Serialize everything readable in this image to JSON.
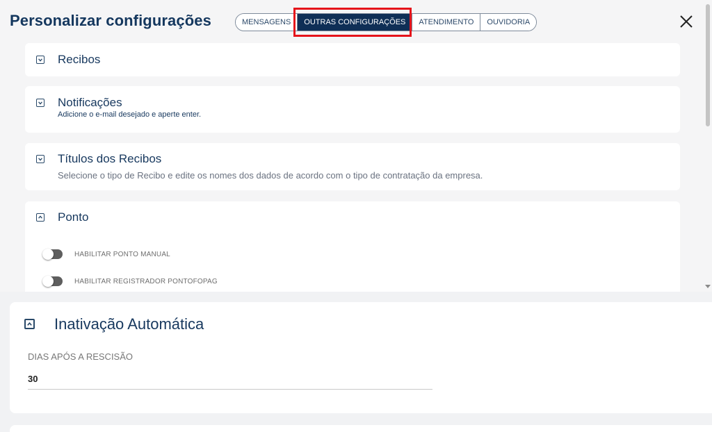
{
  "modal": {
    "title": "Personalizar configurações",
    "tabs": [
      {
        "label": "MENSAGENS",
        "active": false
      },
      {
        "label": "OUTRAS CONFIGURAÇÕES",
        "active": true
      },
      {
        "label": "ATENDIMENTO",
        "active": false
      },
      {
        "label": "OUVIDORIA",
        "active": false
      }
    ],
    "close_icon": "close-icon"
  },
  "sections": {
    "recibos": {
      "title": "Recibos",
      "state": "collapsed"
    },
    "notificacoes": {
      "title": "Notificações",
      "subtitle": "Adicione o e-mail desejado e aperte enter.",
      "state": "collapsed"
    },
    "titulos": {
      "title": "Títulos dos Recibos",
      "subtitle": "Selecione o tipo de Recibo e edite os nomes dos dados de acordo com o tipo de contratação da empresa.",
      "state": "collapsed"
    },
    "ponto": {
      "title": "Ponto",
      "state": "expanded",
      "toggles": [
        {
          "label": "HABILITAR PONTO MANUAL",
          "enabled": false
        },
        {
          "label": "HABILITAR REGISTRADOR PONTOFOPAG",
          "enabled": false
        }
      ]
    }
  },
  "background": {
    "title": "Inativação Automática",
    "field_label": "DIAS APÓS A RESCISÃO",
    "field_value": "30"
  },
  "colors": {
    "primary": "#0f2f56",
    "highlight": "#e5141b",
    "text": "#17385e"
  }
}
